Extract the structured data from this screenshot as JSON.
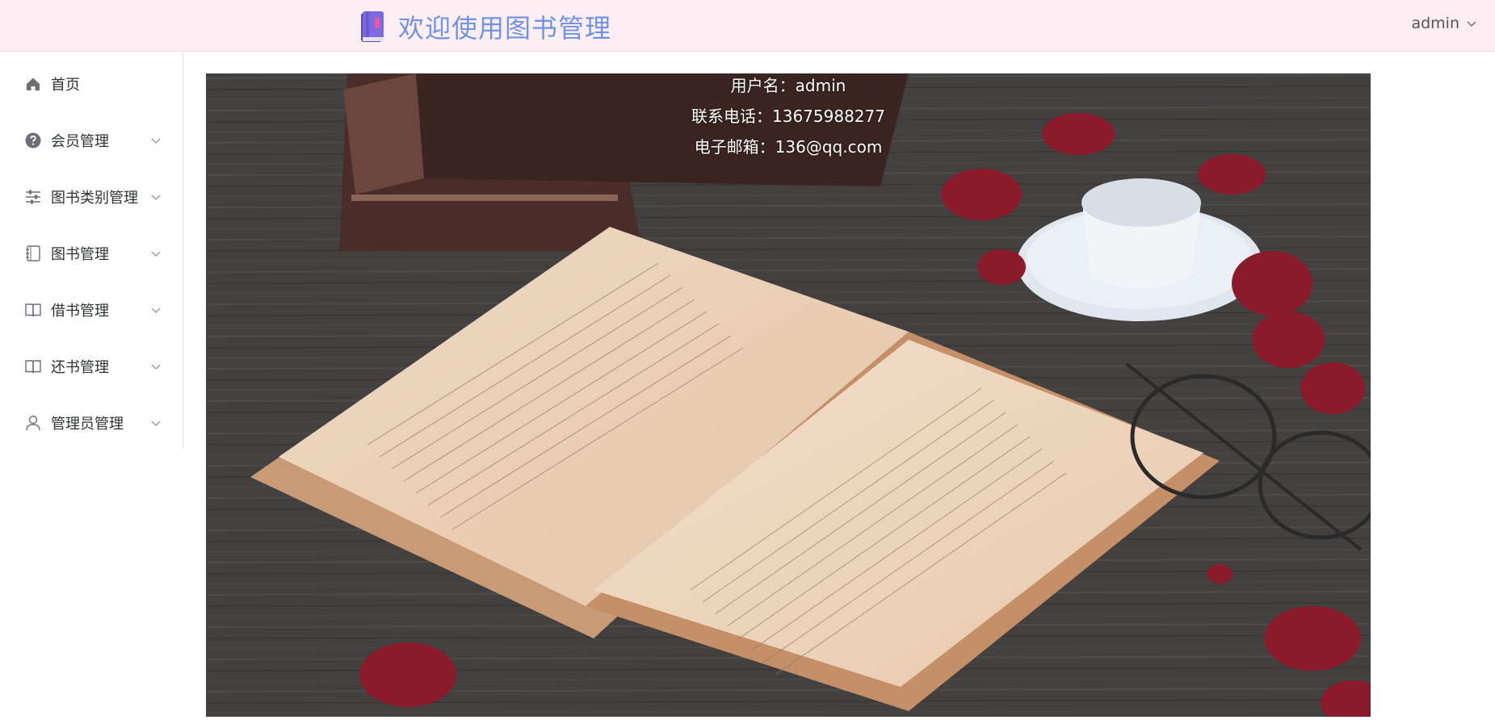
{
  "header": {
    "title": "欢迎使用图书管理",
    "user": "admin"
  },
  "sidebar": {
    "items": [
      {
        "label": "首页",
        "icon": "home-icon"
      },
      {
        "label": "会员管理",
        "icon": "question-circle-icon"
      },
      {
        "label": "图书类别管理",
        "icon": "sliders-icon"
      },
      {
        "label": "图书管理",
        "icon": "notebook-icon"
      },
      {
        "label": "借书管理",
        "icon": "open-book-icon"
      },
      {
        "label": "还书管理",
        "icon": "open-book-icon"
      },
      {
        "label": "管理员管理",
        "icon": "user-icon"
      }
    ]
  },
  "profile": {
    "username_line": "用户名：admin",
    "phone_line": "联系电话：13675988277",
    "email_line": "电子邮箱：136@qq.com"
  },
  "colors": {
    "header_bg": "#fdeef3",
    "title": "#6f93ea",
    "logo_purple": "#6f5bd6",
    "logo_pink": "#ea5aa0"
  }
}
